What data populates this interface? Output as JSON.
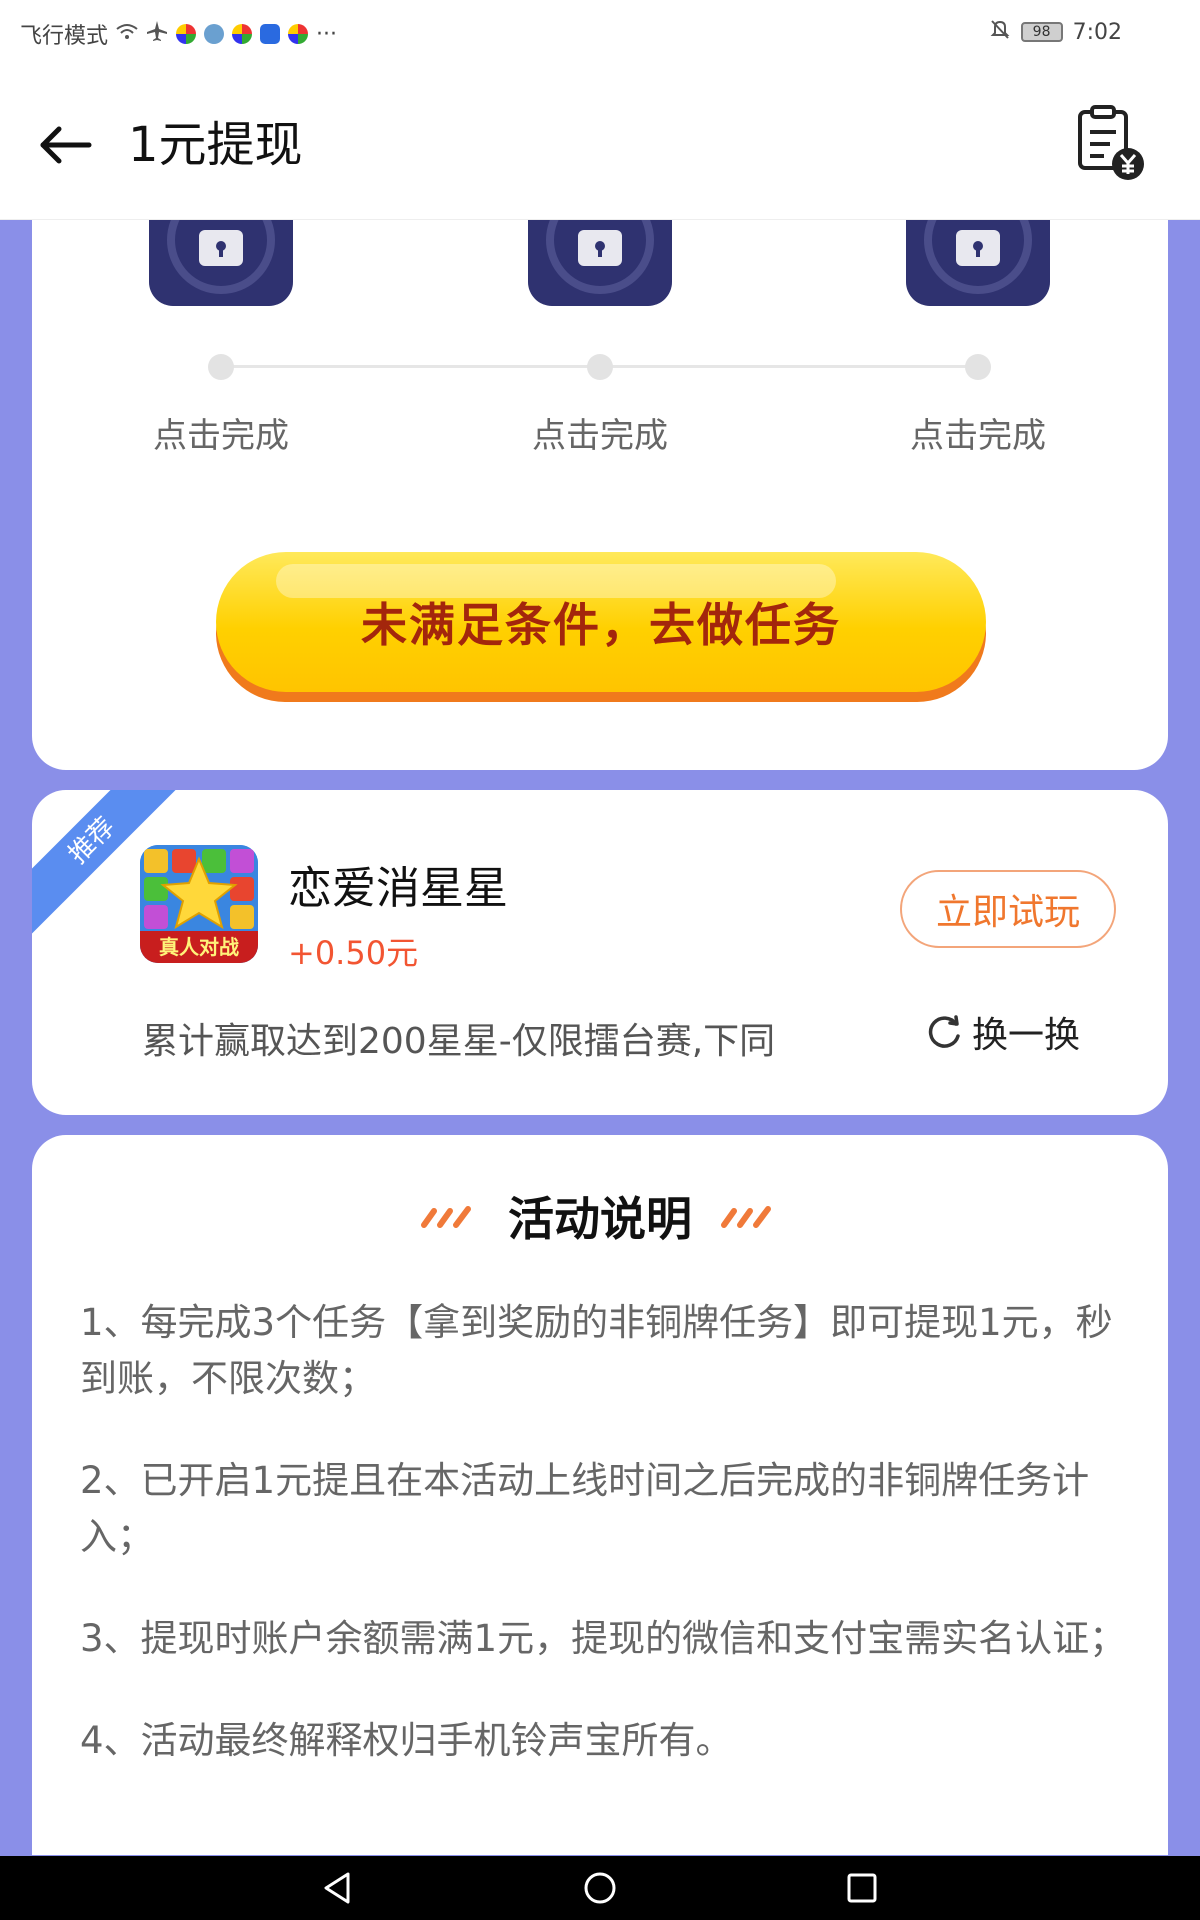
{
  "status_bar": {
    "left_text": "飞行模式",
    "time": "7:02",
    "battery": "98",
    "more": "···"
  },
  "header": {
    "title": "1元提现"
  },
  "steps": [
    {
      "label": "点击完成"
    },
    {
      "label": "点击完成"
    },
    {
      "label": "点击完成"
    }
  ],
  "task_button": {
    "label": "未满足条件，去做任务"
  },
  "recommend": {
    "ribbon": "推荐",
    "app_icon_text": "真人对战",
    "app_name": "恋爱消星星",
    "reward": "+0.50元",
    "try_label": "立即试玩",
    "description": "累计赢取达到200星星-仅限擂台赛,下同",
    "swap_label": "换一换"
  },
  "activity": {
    "title": "活动说明",
    "rules": [
      "1、每完成3个任务【拿到奖励的非铜牌任务】即可提现1元，秒到账，不限次数；",
      "2、已开启1元提且在本活动上线时间之后完成的非铜牌任务计入；",
      "3、提现时账户余额需满1元，提现的微信和支付宝需实名认证；",
      "4、活动最终解释权归手机铃声宝所有。"
    ]
  },
  "colors": {
    "page_bg": "#8a8fe8",
    "accent_orange": "#f0772e",
    "reward_red": "#f25532",
    "button_yellow": "#ffd000",
    "button_text": "#a3260c",
    "ribbon_blue": "#5a8df0"
  }
}
